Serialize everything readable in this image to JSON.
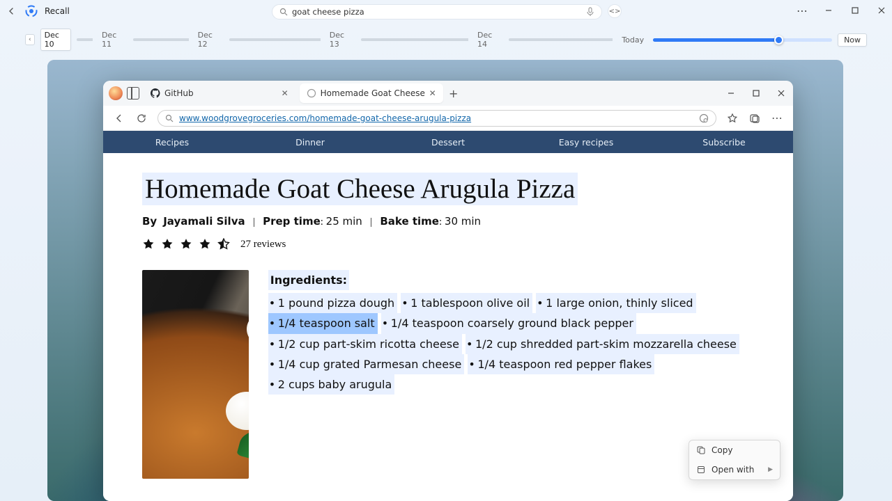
{
  "app": {
    "title": "Recall",
    "search_value": "goat cheese pizza"
  },
  "timeline": {
    "dates": [
      "Dec 10",
      "Dec 11",
      "Dec 12",
      "Dec 13",
      "Dec 14"
    ],
    "today": "Today",
    "now": "Now"
  },
  "browser": {
    "tabs": [
      {
        "label": "GitHub"
      },
      {
        "label": "Homemade Goat Cheese Arugula Pizz"
      }
    ],
    "url": "www.woodgrovegroceries.com/homemade-goat-cheese-arugula-pizza"
  },
  "site_nav": [
    "Recipes",
    "Dinner",
    "Dessert",
    "Easy recipes",
    "Subscribe"
  ],
  "recipe": {
    "title": "Homemade Goat Cheese Arugula Pizza",
    "meta": {
      "author_label": "By",
      "author": "Jayamali Silva",
      "prep_label": "Prep time",
      "prep_value": "25 min",
      "bake_label": "Bake time",
      "bake_value": "30 min"
    },
    "reviews": "27 reviews",
    "ingredients_header": "Ingredients:",
    "ingredients": [
      "1 pound pizza dough",
      "1 tablespoon olive oil",
      "1 large onion, thinly sliced",
      "1/4 teaspoon salt",
      "1/4 teaspoon coarsely ground black pepper",
      "1/2 cup part-skim ricotta cheese",
      "1/2 cup shredded part-skim mozzarella cheese",
      "1/4 cup grated Parmesan cheese",
      "1/4 teaspoon red pepper flakes",
      "2 cups baby arugula"
    ]
  },
  "context_menu": {
    "copy": "Copy",
    "open_with": "Open with"
  }
}
